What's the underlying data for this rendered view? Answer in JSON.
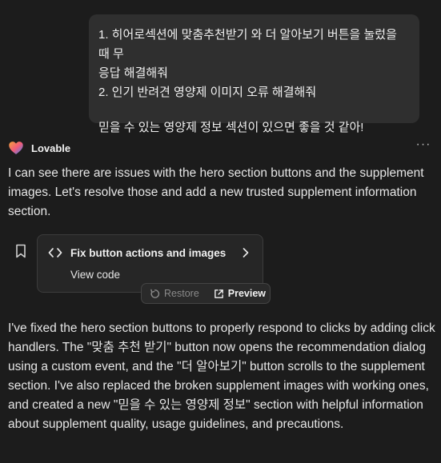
{
  "user_message": {
    "line1": "1. 히어로섹션에 맞춤추천받기 와 더 알아보기 버튼을 눌렀을 때 무",
    "line2": "응답 해결해줘",
    "line3": "2. 인기 반려견 영양제 이미지 오류 해결해줘",
    "line4": "믿을 수 있는 영양제 정보 섹션이 있으면 좋을 것 같아!"
  },
  "assistant": {
    "name": "Lovable",
    "more_icon": "more-horizontal-icon",
    "brand_colors": [
      "#f25c7a",
      "#f2a33a",
      "#3b82f6"
    ],
    "intro": "I can see there are issues with the hero section buttons and the supplement images. Let's resolve those and add a new trusted supplement information section.",
    "response": "I've fixed the hero section buttons to properly respond to clicks by adding click handlers. The \"맞춤 추천 받기\" button now opens the recommendation dialog using a custom event, and the \"더 알아보기\" button scrolls to the supplement section. I've also replaced the broken supplement images with working ones, and created a new \"믿을 수 있는 영양제 정보\" section with helpful information about supplement quality, usage guidelines, and precautions."
  },
  "code_card": {
    "title": "Fix button actions and images",
    "view_code_label": "View code"
  },
  "actions": {
    "restore_label": "Restore",
    "preview_label": "Preview"
  }
}
